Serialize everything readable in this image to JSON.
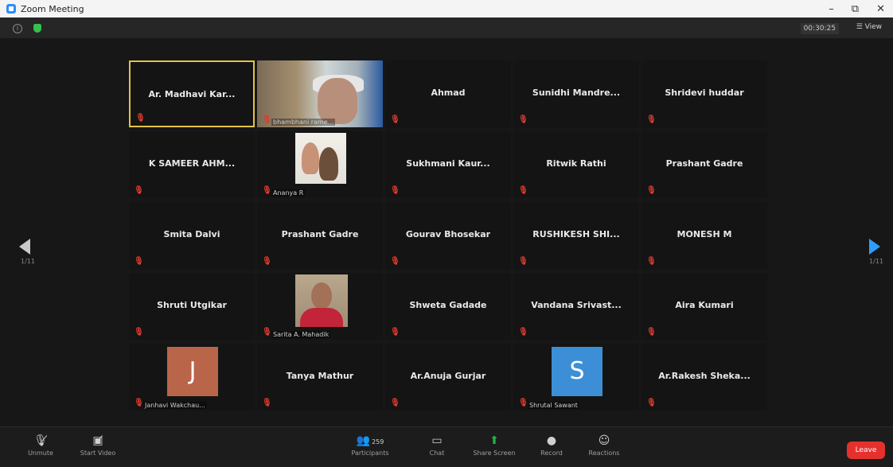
{
  "window": {
    "title": "Zoom Meeting",
    "controls": [
      "–",
      "⧉",
      "✕"
    ]
  },
  "topbar": {
    "timer": "00:30:25",
    "view_label": "View"
  },
  "navigation": {
    "left_page": "1/11",
    "right_page": "1/11"
  },
  "grid": [
    [
      {
        "name": "Ar. Madhavi Kar...",
        "caption": "",
        "type": "name",
        "muted": true,
        "active": true
      },
      {
        "name": "",
        "caption": "bhambhani rame...",
        "type": "video-elder",
        "muted": true
      },
      {
        "name": "Ahmad",
        "caption": "",
        "type": "name",
        "muted": true
      },
      {
        "name": "Sunidhi Mandre...",
        "caption": "",
        "type": "name",
        "muted": true
      },
      {
        "name": "Shridevi huddar",
        "caption": "",
        "type": "name",
        "muted": true
      }
    ],
    [
      {
        "name": "K SAMEER AHM...",
        "caption": "",
        "type": "name",
        "muted": true
      },
      {
        "name": "",
        "caption": "Ananya R",
        "type": "video-kids",
        "muted": true
      },
      {
        "name": "Sukhmani Kaur...",
        "caption": "",
        "type": "name",
        "muted": true
      },
      {
        "name": "Ritwik Rathi",
        "caption": "",
        "type": "name",
        "muted": true
      },
      {
        "name": "Prashant Gadre",
        "caption": "",
        "type": "name",
        "muted": true
      }
    ],
    [
      {
        "name": "Smita Dalvi",
        "caption": "",
        "type": "name",
        "muted": true
      },
      {
        "name": "Prashant Gadre",
        "caption": "",
        "type": "name",
        "muted": true
      },
      {
        "name": "Gourav Bhosekar",
        "caption": "",
        "type": "name",
        "muted": true
      },
      {
        "name": "RUSHIKESH SHI...",
        "caption": "",
        "type": "name",
        "muted": true
      },
      {
        "name": "MONESH M",
        "caption": "",
        "type": "name",
        "muted": true
      }
    ],
    [
      {
        "name": "Shruti Utgikar",
        "caption": "",
        "type": "name",
        "muted": true
      },
      {
        "name": "",
        "caption": "Sarita A. Mahadik",
        "type": "video-woman",
        "muted": true
      },
      {
        "name": "Shweta Gadade",
        "caption": "",
        "type": "name",
        "muted": true
      },
      {
        "name": "Vandana Srivast...",
        "caption": "",
        "type": "name",
        "muted": true
      },
      {
        "name": "Aira Kumari",
        "caption": "",
        "type": "name",
        "muted": true
      }
    ],
    [
      {
        "name": "",
        "caption": "Janhavi Wakchau...",
        "type": "avatar",
        "avatar_letter": "J",
        "avatar_color": "#b9654a",
        "muted": true
      },
      {
        "name": "Tanya Mathur",
        "caption": "",
        "type": "name",
        "muted": true
      },
      {
        "name": "Ar.Anuja Gurjar",
        "caption": "",
        "type": "name",
        "muted": true
      },
      {
        "name": "",
        "caption": "Shrutal Sawant",
        "type": "avatar",
        "avatar_letter": "S",
        "avatar_color": "#3c8fd6",
        "muted": true
      },
      {
        "name": "Ar.Rakesh Sheka...",
        "caption": "",
        "type": "name",
        "muted": true
      }
    ]
  ],
  "toolbar": {
    "unmute": "Unmute",
    "start_video": "Start Video",
    "participants": "Participants",
    "participants_count": "259",
    "chat": "Chat",
    "share_screen": "Share Screen",
    "record": "Record",
    "reactions": "Reactions",
    "leave": "Leave"
  },
  "colors": {
    "active_border": "#e3c442",
    "mute_red": "#e03b2e",
    "leave_red": "#e5312e",
    "share_green": "#23b54a",
    "nav_blue": "#2f9cff"
  }
}
